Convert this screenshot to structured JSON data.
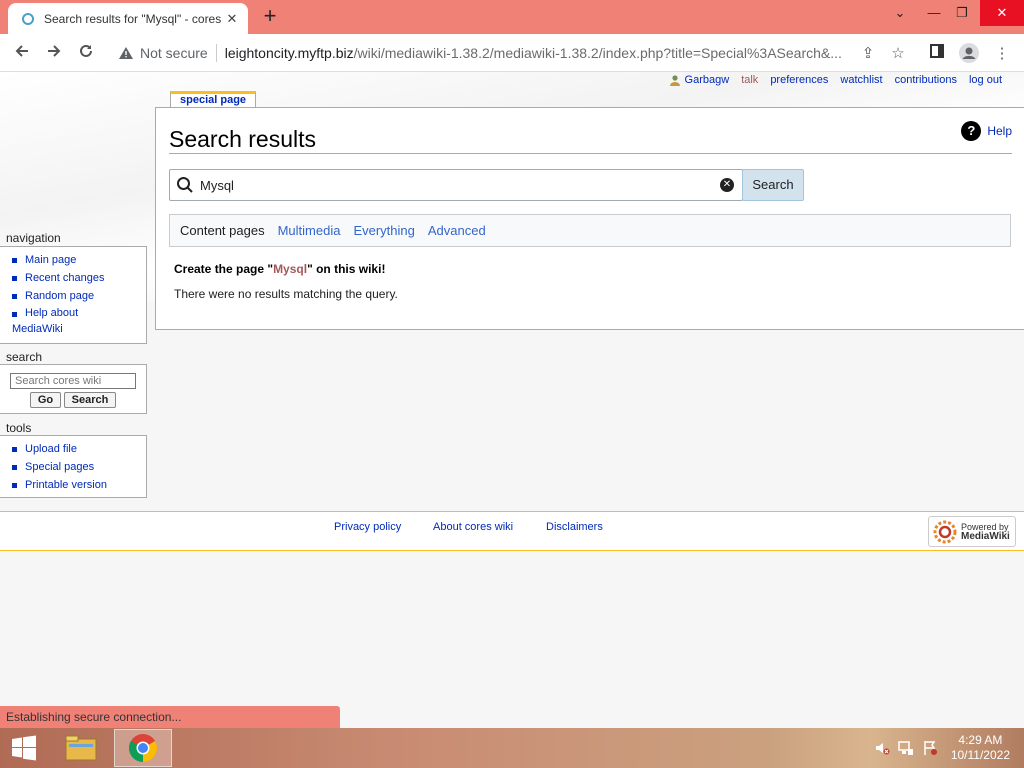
{
  "browser": {
    "tab_title": "Search results for \"Mysql\" - cores",
    "new_tab": "+",
    "not_secure": "Not secure",
    "url_host": "leightoncity.myftp.biz",
    "url_path": "/wiki/mediawiki-1.38.2/mediawiki-1.38.2/index.php?title=Special%3ASearch&...",
    "status": "Establishing secure connection..."
  },
  "personal": {
    "user": "Garbagw",
    "talk": "talk",
    "preferences": "preferences",
    "watchlist": "watchlist",
    "contributions": "contributions",
    "logout": "log out"
  },
  "tab": {
    "label": "special page"
  },
  "content": {
    "title": "Search results",
    "help": "Help",
    "search_value": "Mysql",
    "search_button": "Search",
    "profiles": {
      "current": "Content pages",
      "multimedia": "Multimedia",
      "everything": "Everything",
      "advanced": "Advanced"
    },
    "create_prefix": "Create the page \"",
    "create_query": "Mysql",
    "create_suffix": "\" on this wiki!",
    "no_results": "There were no results matching the query."
  },
  "sidebar": {
    "navigation_heading": "navigation",
    "navigation": [
      "Main page",
      "Recent changes",
      "Random page"
    ],
    "help_line1": "Help about",
    "help_line2": "MediaWiki",
    "search_heading": "search",
    "search_placeholder": "Search cores wiki",
    "go_button": "Go",
    "search_button": "Search",
    "tools_heading": "tools",
    "tools": [
      "Upload file",
      "Special pages",
      "Printable version"
    ]
  },
  "footer": {
    "privacy": "Privacy policy",
    "about": "About cores wiki",
    "disclaimers": "Disclaimers",
    "powered_line1": "Powered by",
    "powered_line2": "MediaWiki"
  },
  "taskbar": {
    "time": "4:29 AM",
    "date": "10/11/2022"
  }
}
